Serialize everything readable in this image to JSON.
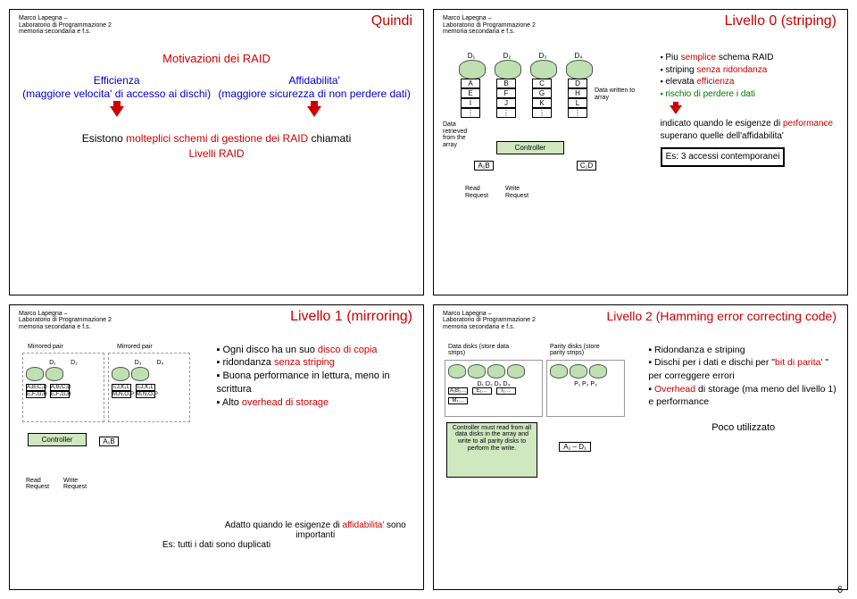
{
  "header": {
    "author": "Marco Lapegna –",
    "lab": "Laboratorio di Programmazione 2",
    "mem": "memoria secondaria e f.s."
  },
  "slide1": {
    "title": "Quindi",
    "motivation": "Motivazioni dei RAID",
    "left": {
      "h": "Efficienza",
      "p": "(maggiore velocita' di accesso ai dischi)"
    },
    "right": {
      "h": "Affidabilita'",
      "p": "(maggiore sicurezza di non perdere dati)"
    },
    "bottom_a": "Esistono ",
    "bottom_b": "molteplici schemi di gestione dei RAID ",
    "bottom_c": "chiamati",
    "bottom_d": "Livelli RAID"
  },
  "slide2": {
    "title": "Livello 0 (striping)",
    "bullets": {
      "b1a": "Piu",
      "b1b": " semplice",
      "b1c": " schema RAID",
      "b2a": "striping ",
      "b2b": "senza ridondanza",
      "b3a": "elevata ",
      "b3b": "efficienza",
      "b4a": "rischio di perdere i dati"
    },
    "mid": {
      "a": "indicato quando le esigenze di ",
      "b": "performance",
      "c": " superano quelle dell'affidabilita'"
    },
    "box": "Es: 3 accessi contemporanei",
    "diag": {
      "d1": "D₁",
      "d2": "D₂",
      "d3": "D₃",
      "d4": "D₄",
      "c_a": "A",
      "c_b": "B",
      "c_c": "C",
      "c_d": "D",
      "c_e": "E",
      "c_f": "F",
      "c_g": "G",
      "c_h": "H",
      "c_i": "I",
      "c_j": "J",
      "c_k": "K",
      "c_l": "L",
      "dr": "Data retrieved from the array",
      "dw": "Data written to array",
      "ctrl": "Controller",
      "ab": "A₁B",
      "cd": "C₁D",
      "rr": "Read Request",
      "wr": "Write Request"
    }
  },
  "slide3": {
    "title": "Livello 1 (mirroring)",
    "bullets": {
      "b1a": "Ogni disco ha un suo ",
      "b1b": "disco di copia",
      "b2a": "ridondanza ",
      "b2b": "senza striping",
      "b3": "Buona performance in lettura, meno in scrittura",
      "b4a": "Alto ",
      "b4b": "overhead di storage"
    },
    "bottom": {
      "a": "Adatto quando le esigenze di ",
      "b": "affidabilita'",
      "c": " sono importanti"
    },
    "es": "Es: tutti i dati sono duplicati",
    "diag": {
      "mp1": "Mirrored pair",
      "mp2": "Mirrored pair",
      "d1": "D₁",
      "d2": "D₂",
      "d3": "D₃",
      "d4": "D₄",
      "s1": "A₁B₁C₁D",
      "s1b": "E₁F₁G₁H",
      "s2": "A₁B₁C₁D",
      "s2b": "E₁F₁G₁H",
      "s3": "I₁J₁K₁L",
      "s3b": "M₁N₁O₁P",
      "s4": "I₁J₁K₁L",
      "s4b": "M₁N₁O₁P",
      "ctrl": "Controller",
      "ab": "A₁B",
      "rr": "Read Request",
      "wr": "Write Request"
    }
  },
  "slide4": {
    "title": "Livello 2 (Hamming error correcting code)",
    "bullets": {
      "b1": "Ridondanza e striping",
      "b2a": "Dischi per i dati e dischi per \"",
      "b2b": "bit di parita'",
      "b2c": " \" per correggere errori",
      "b3a": "Overhead",
      "b3b": " di storage (ma meno del livello 1) e performance"
    },
    "bottom": "Poco  utilizzato",
    "diag": {
      "dd": "Data disks (store data strips)",
      "pd": "Parity disks (store parity strips)",
      "d1": "D₁",
      "d2": "D₂",
      "d3": "D₃",
      "d4": "D₄",
      "p1": "P₁",
      "p2": "P₂",
      "p3": "P₃",
      "ctrl": "Controller must read from all data disks in the array and write to all parity disks to perform the write.",
      "a": "A₁B₁…",
      "e": "E₁…",
      "i": "I₁…",
      "m": "M₁…",
      "ap": "A₁ – D₁"
    }
  },
  "pagenum": "6"
}
